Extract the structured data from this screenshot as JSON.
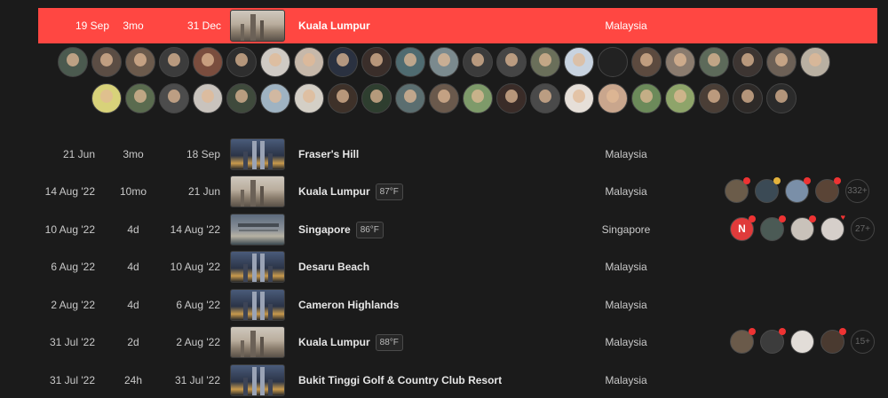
{
  "highlight": {
    "start": "19 Sep",
    "duration": "3mo",
    "end": "31 Dec",
    "city": "Kuala Lumpur",
    "country": "Malaysia"
  },
  "avatar_rows": [
    [
      "#4b5a4f",
      "#5b4d44",
      "#6b5a4c",
      "#3c3c3c",
      "#7a4d3e",
      "#2e2e2e",
      "#cfcac4",
      "#c6b8aa",
      "#2a3140",
      "#3a2e2a",
      "#4f6b70",
      "#7b8a8e",
      "#3b3b3b",
      "#454545",
      "#6a6f5a",
      "#c8d3e0",
      "#222222",
      "#5c4a3f",
      "#8a7b6e",
      "#5d6a5a",
      "#3d3532",
      "#6c6056",
      "#b9b0a2"
    ],
    [
      "#d8d27a",
      "#5a6b4f",
      "#4c4c4c",
      "#c9c3bd",
      "#3f4a3c",
      "#9fb3c2",
      "#d4cfc6",
      "#3e3129",
      "#2e3e2f",
      "#5b6e70",
      "#6a594c",
      "#7e9a6a",
      "#3a2c28",
      "#4a4a4a",
      "#e6dfd8",
      "#c9a68d",
      "#6c8a5a",
      "#8ea46a",
      "#4a3e36",
      "#2e2a28",
      "#2b2b2b"
    ]
  ],
  "trips": [
    {
      "start": "21 Jun",
      "duration": "3mo",
      "end": "18 Sep",
      "city": "Fraser's Hill",
      "temp": "",
      "country": "Malaysia",
      "thumb": "twin",
      "members": [],
      "count": ""
    },
    {
      "start": "14 Aug '22",
      "duration": "10mo",
      "end": "21 Jun",
      "city": "Kuala Lumpur",
      "temp": "87°F",
      "country": "Malaysia",
      "thumb": "hazy",
      "members": [
        {
          "badge": "dot",
          "color": "#6b5c4a"
        },
        {
          "badge": "crown",
          "color": "#3b4a55"
        },
        {
          "badge": "dot",
          "color": "#7a8fa8"
        },
        {
          "badge": "dot",
          "color": "#5a4436"
        }
      ],
      "count": "332+"
    },
    {
      "start": "10 Aug '22",
      "duration": "4d",
      "end": "14 Aug '22",
      "city": "Singapore",
      "temp": "86°F",
      "country": "Singapore",
      "thumb": "sg",
      "members": [
        {
          "badge": "logo",
          "color": "#e03b3b",
          "label": "N"
        },
        {
          "badge": "dot",
          "color": "#4b5a55"
        },
        {
          "badge": "dot",
          "color": "#c9c2ba"
        },
        {
          "badge": "heart",
          "color": "#d6cfca"
        }
      ],
      "count": "27+"
    },
    {
      "start": "6 Aug '22",
      "duration": "4d",
      "end": "10 Aug '22",
      "city": "Desaru Beach",
      "temp": "",
      "country": "Malaysia",
      "thumb": "twin",
      "members": [],
      "count": ""
    },
    {
      "start": "2 Aug '22",
      "duration": "4d",
      "end": "6 Aug '22",
      "city": "Cameron Highlands",
      "temp": "",
      "country": "Malaysia",
      "thumb": "twin",
      "members": [],
      "count": ""
    },
    {
      "start": "31 Jul '22",
      "duration": "2d",
      "end": "2 Aug '22",
      "city": "Kuala Lumpur",
      "temp": "88°F",
      "country": "Malaysia",
      "thumb": "hazy",
      "members": [
        {
          "badge": "dot",
          "color": "#6a5a4a"
        },
        {
          "badge": "dot",
          "color": "#3c3c3c"
        },
        {
          "badge": "none",
          "color": "#e2ddd8"
        },
        {
          "badge": "dot",
          "color": "#4a3a30"
        }
      ],
      "count": "15+"
    },
    {
      "start": "31 Jul '22",
      "duration": "24h",
      "end": "31 Jul '22",
      "city": "Bukit Tinggi Golf & Country Club Resort",
      "temp": "",
      "country": "Malaysia",
      "thumb": "twin",
      "members": [],
      "count": ""
    }
  ]
}
